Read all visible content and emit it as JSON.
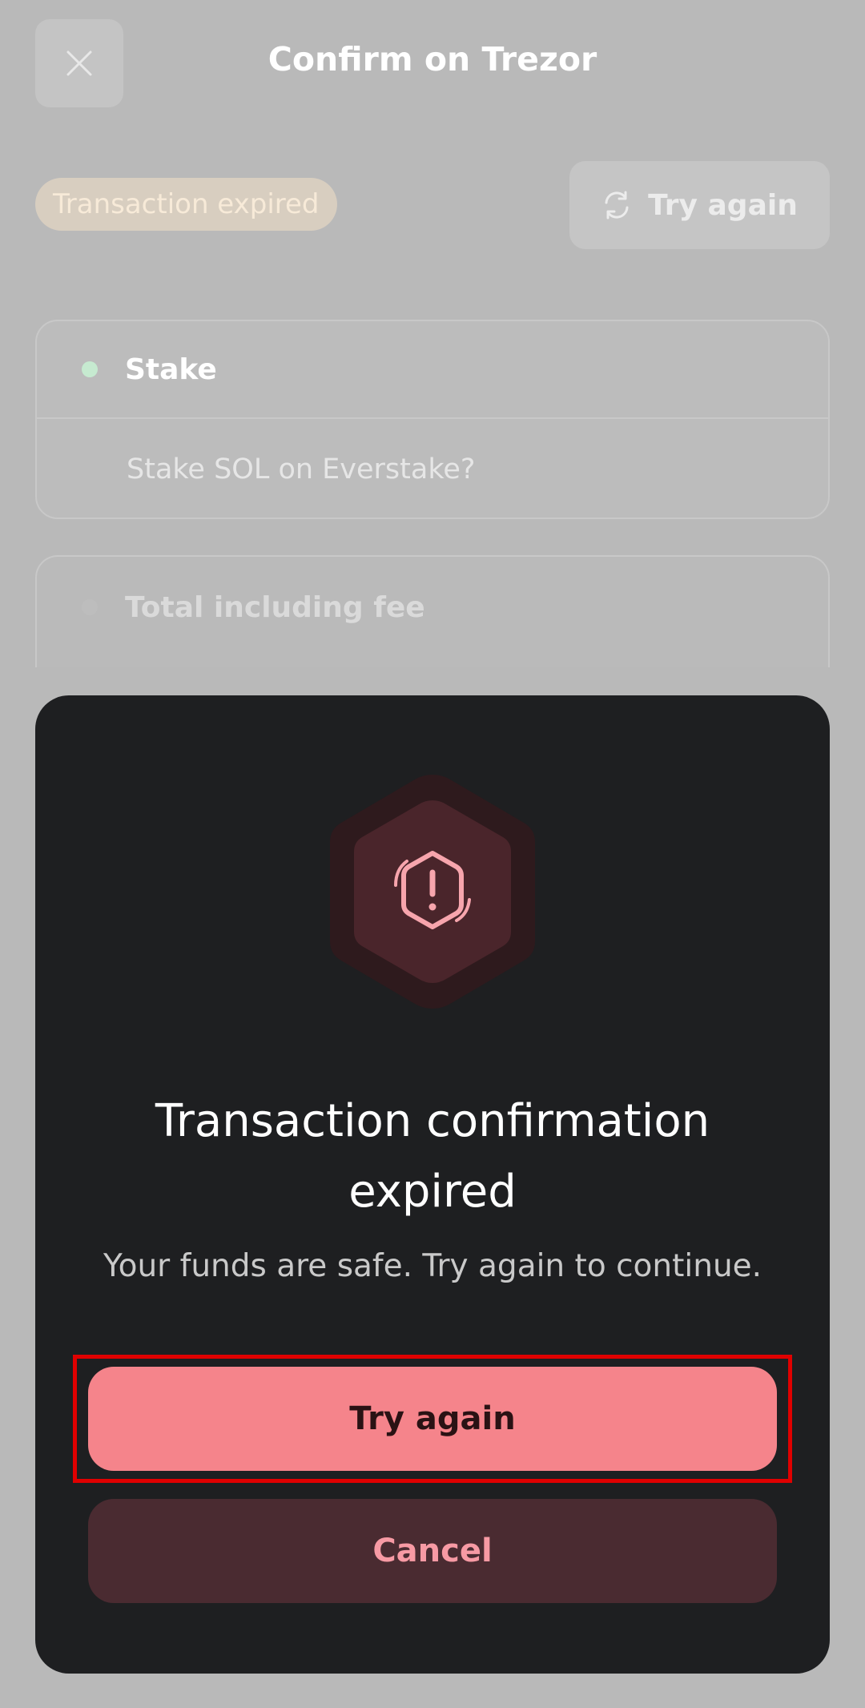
{
  "header": {
    "title": "Confirm on Trezor",
    "close_icon": "close-icon"
  },
  "status": {
    "badge": "Transaction expired",
    "retry_label": "Try again",
    "retry_icon": "refresh-icon"
  },
  "steps": {
    "stake_label": "Stake",
    "stake_detail": "Stake SOL on Everstake?",
    "total_label": "Total including fee"
  },
  "modal": {
    "icon": "warning-hexagon-icon",
    "title_line1": "Transaction confirmation",
    "title_line2": "expired",
    "subtitle": "Your funds are safe. Try again to continue.",
    "primary_label": "Try again",
    "secondary_label": "Cancel"
  },
  "colors": {
    "primary_button": "#f5848b",
    "secondary_button": "#4a2b31",
    "sheet_background": "#1e1f21",
    "highlight_border": "#e00000"
  }
}
